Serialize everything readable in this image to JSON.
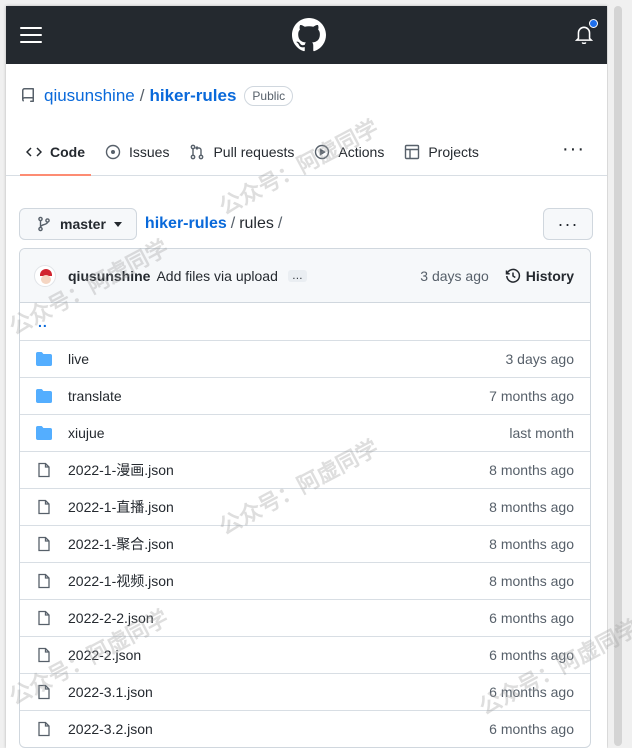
{
  "header": {
    "logo_icon": "github-mark-icon",
    "bell_icon": "bell-icon",
    "accent": "#1f6feb"
  },
  "repo": {
    "owner": "qiusunshine",
    "separator": "/",
    "name": "hiker-rules",
    "visibility": "Public"
  },
  "tabs": [
    {
      "label": "Code",
      "icon": "code-icon",
      "active": true
    },
    {
      "label": "Issues",
      "icon": "issue-icon"
    },
    {
      "label": "Pull requests",
      "icon": "pull-request-icon"
    },
    {
      "label": "Actions",
      "icon": "play-icon"
    },
    {
      "label": "Projects",
      "icon": "table-icon"
    }
  ],
  "tabs_more": "···",
  "toolbar": {
    "branch": "master",
    "crumb_repo": "hiker-rules",
    "crumb_sep1": "/",
    "crumb_dir": "rules",
    "crumb_sep2": "/",
    "more": "···"
  },
  "commit": {
    "author": "qiusunshine",
    "message": "Add files via upload",
    "ellipsis": "…",
    "age": "3 days ago",
    "history_label": "History"
  },
  "parent_dir": "..",
  "files": [
    {
      "name": "live",
      "type": "dir",
      "age": "3 days ago"
    },
    {
      "name": "translate",
      "type": "dir",
      "age": "7 months ago"
    },
    {
      "name": "xiujue",
      "type": "dir",
      "age": "last month"
    },
    {
      "name": "2022-1-漫画.json",
      "type": "file",
      "age": "8 months ago"
    },
    {
      "name": "2022-1-直播.json",
      "type": "file",
      "age": "8 months ago"
    },
    {
      "name": "2022-1-聚合.json",
      "type": "file",
      "age": "8 months ago"
    },
    {
      "name": "2022-1-视频.json",
      "type": "file",
      "age": "8 months ago"
    },
    {
      "name": "2022-2-2.json",
      "type": "file",
      "age": "6 months ago"
    },
    {
      "name": "2022-2.json",
      "type": "file",
      "age": "6 months ago"
    },
    {
      "name": "2022-3.1.json",
      "type": "file",
      "age": "6 months ago"
    },
    {
      "name": "2022-3.2.json",
      "type": "file",
      "age": "6 months ago"
    }
  ],
  "watermark": "公众号：阿虚同学",
  "colors": {
    "link": "#0969da",
    "header_bg": "#24292f",
    "folder": "#54aeff",
    "tab_underline": "#fd8c73"
  }
}
